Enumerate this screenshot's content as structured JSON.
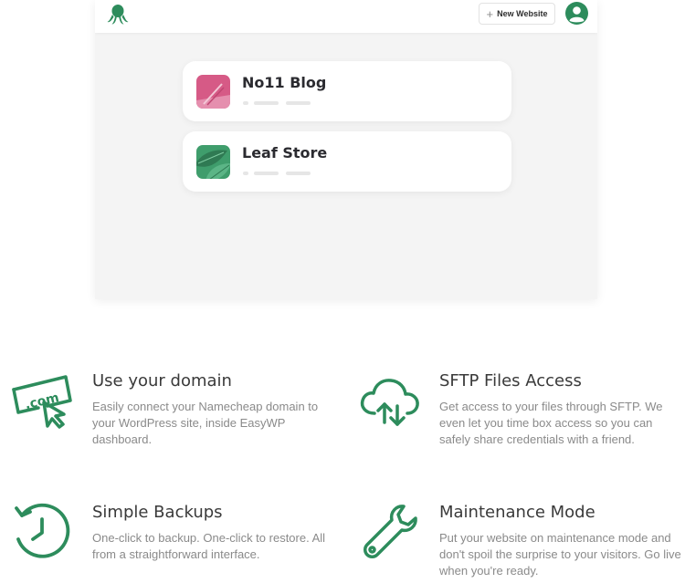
{
  "dashboard": {
    "new_website_label": "New Website",
    "plus_glyph": "+",
    "sites": [
      {
        "name": "No11 Blog",
        "thumb_icon": "pink-blog-thumbnail",
        "thumb_color": "#d65a86"
      },
      {
        "name": "Leaf Store",
        "thumb_icon": "leaf-store-thumbnail",
        "thumb_color": "#3f9d6c"
      }
    ]
  },
  "features": [
    {
      "icon": "dotcom-cursor-icon",
      "title": "Use your domain",
      "description": "Easily connect your Namecheap domain to your WordPress site, inside EasyWP dashboard."
    },
    {
      "icon": "cloud-transfer-icon",
      "title": "SFTP Files Access",
      "description": "Get access to your files through SFTP. We even let you time box access so you can safely share credentials with a friend."
    },
    {
      "icon": "backup-clock-icon",
      "title": "Simple Backups",
      "description": "One-click to backup. One-click to restore. All from a straightforward interface."
    },
    {
      "icon": "wrench-icon",
      "title": "Maintenance Mode",
      "description": "Put your website on maintenance mode and don't spoil the surprise to your visitors. Go live when you're ready."
    }
  ],
  "colors": {
    "brand_green": "#2d8c5c",
    "text_dark": "#2b2b30",
    "text_muted": "#8a8a8a",
    "panel_bg": "#f4f4f4"
  }
}
